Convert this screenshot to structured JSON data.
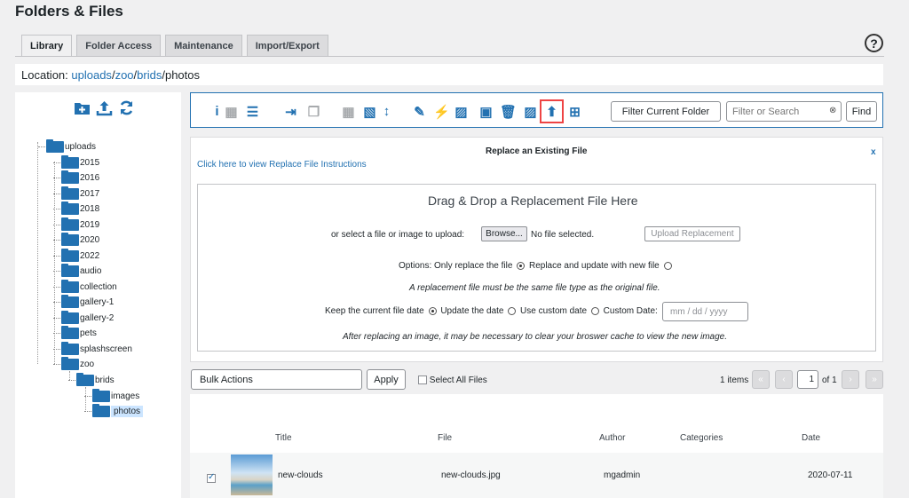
{
  "page_title": "Folders & Files",
  "tabs": [
    "Library",
    "Folder Access",
    "Maintenance",
    "Import/Export"
  ],
  "help_icon": "?",
  "location": {
    "label": "Location:",
    "parts": [
      "uploads",
      "zoo",
      "brids"
    ],
    "current": "photos",
    "sep": "/"
  },
  "sidebar_icons": [
    "add-folder-icon",
    "upload-icon",
    "refresh-icon"
  ],
  "tree": [
    {
      "label": "uploads"
    },
    {
      "label": "2015"
    },
    {
      "label": "2016"
    },
    {
      "label": "2017"
    },
    {
      "label": "2018"
    },
    {
      "label": "2019"
    },
    {
      "label": "2020"
    },
    {
      "label": "2022"
    },
    {
      "label": "audio"
    },
    {
      "label": "collection"
    },
    {
      "label": "gallery-1"
    },
    {
      "label": "gallery-2"
    },
    {
      "label": "pets"
    },
    {
      "label": "splashscreen"
    },
    {
      "label": "zoo"
    },
    {
      "label": "brids"
    },
    {
      "label": "images"
    },
    {
      "label": "photos"
    }
  ],
  "toolbar": {
    "icons": [
      "info-icon",
      "grid-view-icon",
      "list-view-icon",
      "move-icon",
      "copy-icon",
      "calendar-icon",
      "image-sort-icon",
      "sort-icon",
      "rename-icon",
      "regenerate-icon",
      "gallery-icon",
      "embed-icon",
      "delete-icon",
      "image-icon",
      "replace-file-icon",
      "sitemap-icon"
    ],
    "filter_label": "Filter Current Folder",
    "search_placeholder": "Filter or Search",
    "find_label": "Find"
  },
  "replace": {
    "heading": "Replace an Existing File",
    "close": "x",
    "instructions_link": "Click here to view Replace File Instructions",
    "drop_title": "Drag & Drop a Replacement File Here",
    "select_label": "or select a file or image to upload:",
    "browse_label": "Browse...",
    "no_file": "No file selected.",
    "upload_label": "Upload Replacement",
    "options_label": "Options: Only replace the file",
    "option2": "Replace and update with new file",
    "note1": "A replacement file must be the same file type as the original file.",
    "date_keep": "Keep the current file date",
    "date_update": "Update the date",
    "date_custom": "Use custom date",
    "custom_label": "Custom Date:",
    "date_placeholder": "mm / dd / yyyy",
    "note2": "After replacing an image, it may be necessary to clear your broswer cache to view the new image."
  },
  "bulk": {
    "select_value": "Bulk Actions",
    "apply_label": "Apply",
    "select_all": "Select All Files",
    "items": "1 items",
    "page_first": "«",
    "page_prev": "‹",
    "page_current": "1",
    "page_of": "of 1",
    "page_next": "›",
    "page_last": "»"
  },
  "table": {
    "headers": [
      "Title",
      "File",
      "Author",
      "Categories",
      "Date"
    ],
    "rows": [
      {
        "title": "new-clouds",
        "file": "new-clouds.jpg",
        "author": "mgadmin",
        "categories": "",
        "date": "2020-07-11",
        "checked": true
      }
    ]
  }
}
